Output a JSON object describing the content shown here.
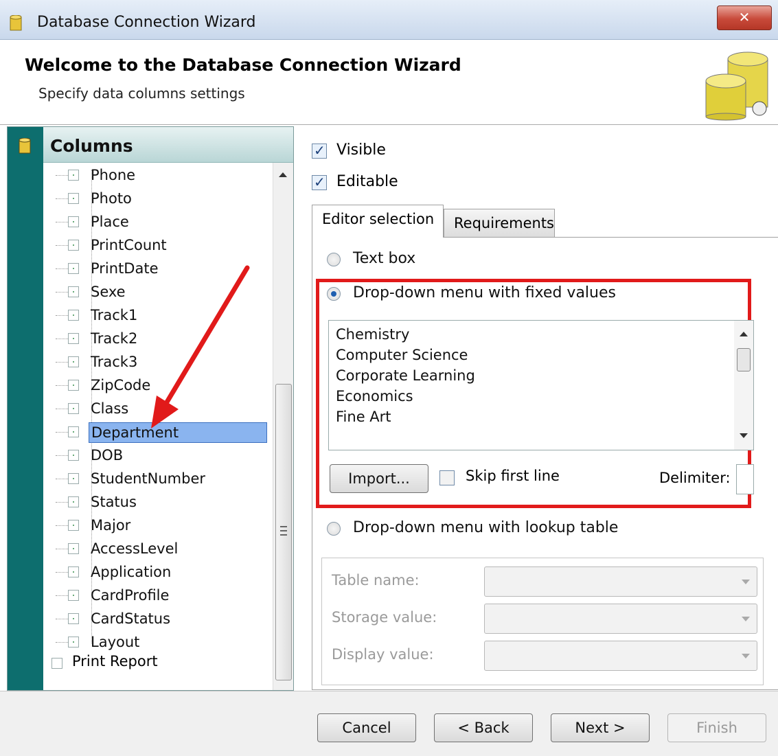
{
  "window": {
    "title": "Database Connection Wizard",
    "close_label": "✕"
  },
  "header": {
    "title": "Welcome to the Database Connection Wizard",
    "subtitle": "Specify data columns settings"
  },
  "columns_panel": {
    "title": "Columns",
    "items": [
      {
        "label": "Phone",
        "selected": false
      },
      {
        "label": "Photo",
        "selected": false
      },
      {
        "label": "Place",
        "selected": false
      },
      {
        "label": "PrintCount",
        "selected": false
      },
      {
        "label": "PrintDate",
        "selected": false
      },
      {
        "label": "Sexe",
        "selected": false
      },
      {
        "label": "Track1",
        "selected": false
      },
      {
        "label": "Track2",
        "selected": false
      },
      {
        "label": "Track3",
        "selected": false
      },
      {
        "label": "ZipCode",
        "selected": false
      },
      {
        "label": "Class",
        "selected": false
      },
      {
        "label": "Department",
        "selected": true
      },
      {
        "label": "DOB",
        "selected": false
      },
      {
        "label": "StudentNumber",
        "selected": false
      },
      {
        "label": "Status",
        "selected": false
      },
      {
        "label": "Major",
        "selected": false
      },
      {
        "label": "AccessLevel",
        "selected": false
      },
      {
        "label": "Application",
        "selected": false
      },
      {
        "label": "CardProfile",
        "selected": false
      },
      {
        "label": "CardStatus",
        "selected": false
      },
      {
        "label": "Layout",
        "selected": false
      }
    ],
    "root_item": "Print Report"
  },
  "settings": {
    "visible_label": "Visible",
    "visible_checked": true,
    "editable_label": "Editable",
    "editable_checked": true
  },
  "tabs": [
    {
      "label": "Editor selection",
      "active": true
    },
    {
      "label": "Requirements",
      "active": false
    }
  ],
  "editor": {
    "text_box_label": "Text box",
    "fixed_values_label": "Drop-down menu with fixed values",
    "fixed_values_items": [
      "Chemistry",
      "Computer Science",
      "Corporate Learning",
      "Economics",
      "Fine Art"
    ],
    "import_label": "Import...",
    "skip_first_line_label": "Skip first line",
    "delimiter_label": "Delimiter:",
    "delimiter_value": "",
    "lookup_label": "Drop-down menu with lookup table",
    "table_name_label": "Table name:",
    "storage_value_label": "Storage value:",
    "display_value_label": "Display value:",
    "selected_option": "Drop-down menu with fixed values"
  },
  "buttons": {
    "cancel": "Cancel",
    "back": "< Back",
    "next": "Next >",
    "finish": "Finish"
  },
  "colors": {
    "highlight_box": "#e11a1a",
    "annotation_arrow": "#e11a1a",
    "selection": "#8ab4ef",
    "sidebar_strip": "#0d6e6e"
  }
}
